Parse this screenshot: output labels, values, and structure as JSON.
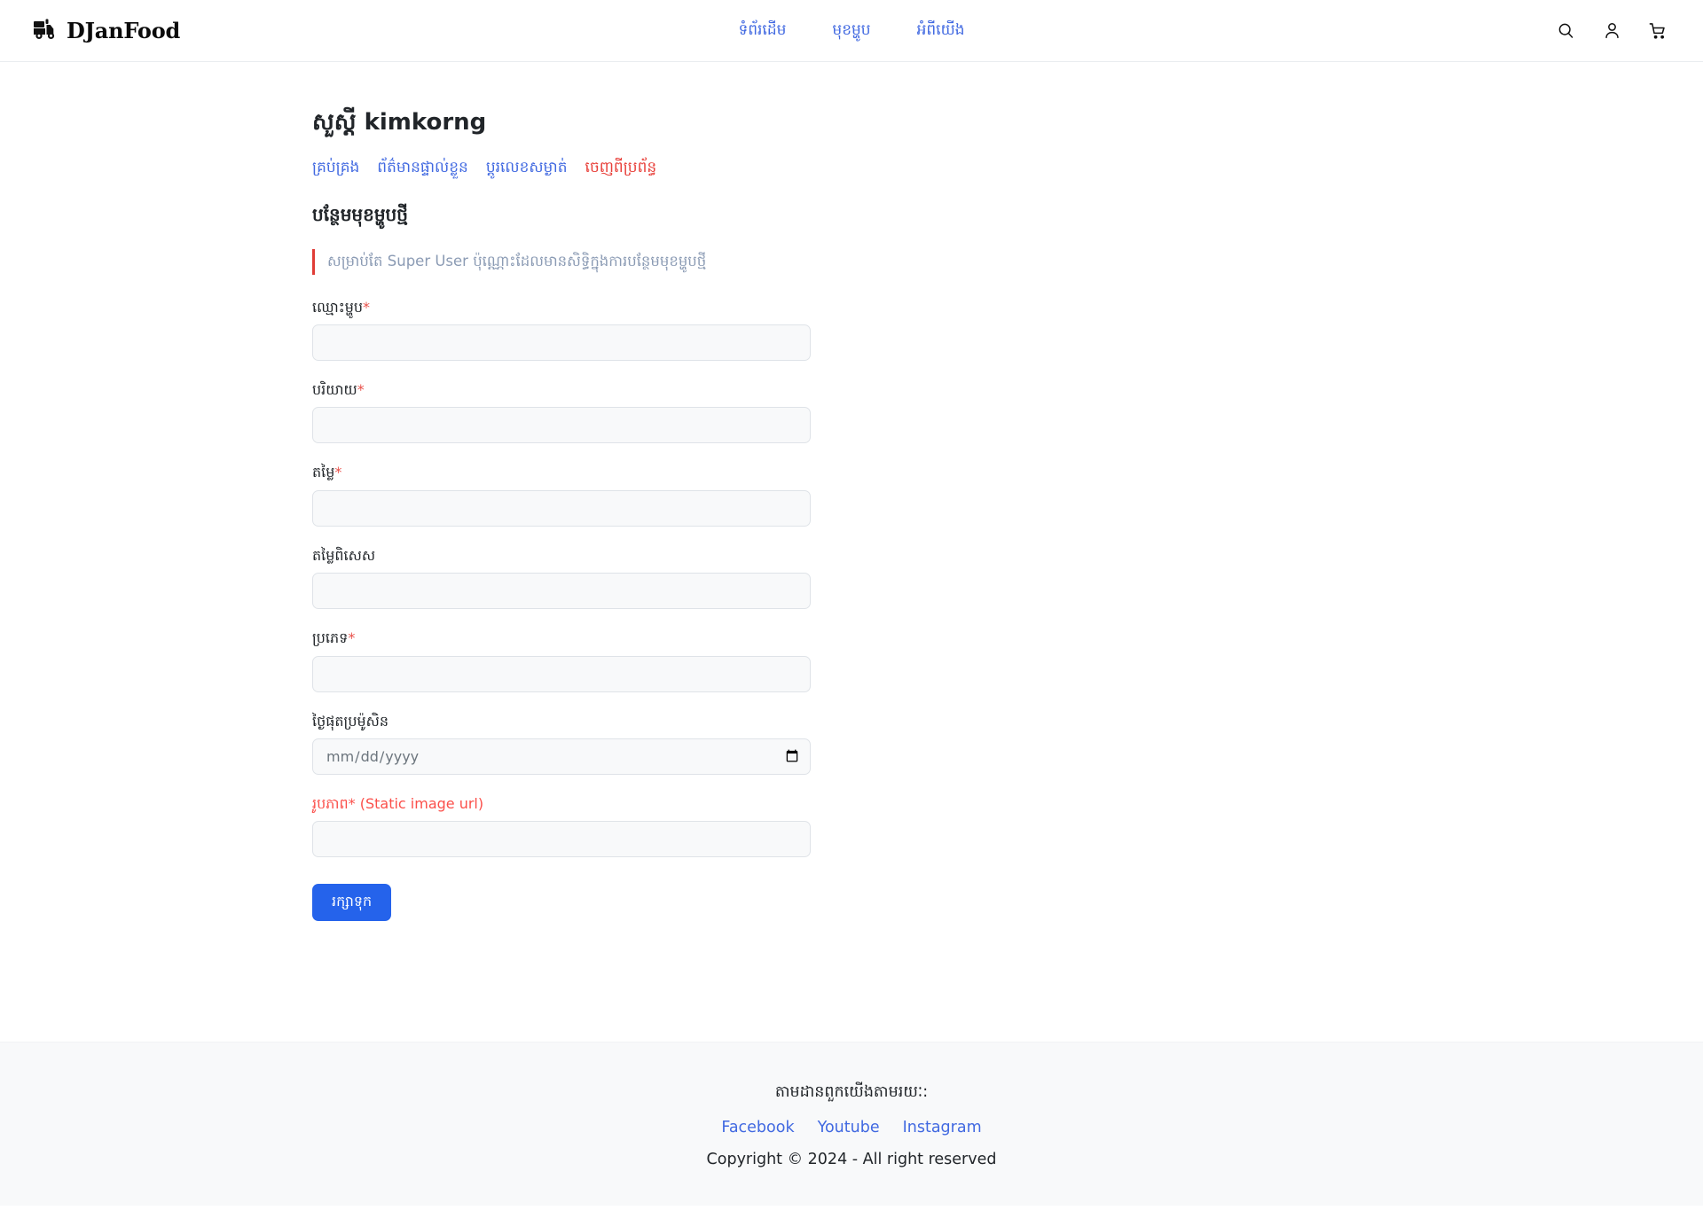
{
  "header": {
    "brand": "DJanFood",
    "brand_icon": "delivery-truck-icon",
    "nav": [
      {
        "label": "ទំព័រដើម"
      },
      {
        "label": "មុខម្ហូប"
      },
      {
        "label": "អំពីយើង"
      }
    ],
    "icons": [
      {
        "name": "search-icon"
      },
      {
        "name": "user-account-icon"
      },
      {
        "name": "shopping-cart-icon"
      }
    ]
  },
  "account": {
    "greeting": "សួស្តី kimkorng",
    "links": [
      {
        "label": "គ្រប់គ្រង",
        "style": "normal"
      },
      {
        "label": "ព័ត៌មានផ្ទាល់ខ្លួន",
        "style": "normal"
      },
      {
        "label": "ប្ដូរលេខសម្ងាត់",
        "style": "normal"
      },
      {
        "label": "ចេញពីប្រព័ន្ធ",
        "style": "danger"
      }
    ]
  },
  "form": {
    "title": "បន្ថែមមុខម្ហូបថ្មី",
    "notice": "សម្រាប់តែ Super User ប៉ុណ្ណោះដែលមានសិទ្ធិក្នុងការបន្ថែមមុខម្ហូបថ្មី",
    "notice_accent": "#e03c36",
    "fields": [
      {
        "label": "ឈ្មោះម្ហូប",
        "required": true,
        "type": "text",
        "value": "",
        "placeholder": ""
      },
      {
        "label": "បរិយាយ",
        "required": true,
        "type": "text",
        "value": "",
        "placeholder": ""
      },
      {
        "label": "តម្លៃ",
        "required": true,
        "type": "text",
        "value": "",
        "placeholder": ""
      },
      {
        "label": "តម្លៃពិសេស",
        "required": false,
        "type": "text",
        "value": "",
        "placeholder": ""
      },
      {
        "label": "ប្រភេទ",
        "required": true,
        "type": "text",
        "value": "",
        "placeholder": ""
      },
      {
        "label": "ថ្ងៃផុតប្រម៉ូសិន",
        "required": false,
        "type": "date",
        "value": "",
        "placeholder": "mm/dd/yyyy"
      },
      {
        "label": "រូបភាព",
        "required": true,
        "suffix": " (Static image url)",
        "all_red": true,
        "type": "text",
        "value": "",
        "placeholder": ""
      }
    ],
    "submit_label": "រក្សាទុក",
    "submit_color": "#2563eb"
  },
  "footer": {
    "title": "តាមដានពួកយើងតាមរយៈ:",
    "links": [
      {
        "label": "Facebook"
      },
      {
        "label": "Youtube"
      },
      {
        "label": "Instagram"
      }
    ],
    "copyright": "Copyright © 2024 - All right reserved"
  }
}
